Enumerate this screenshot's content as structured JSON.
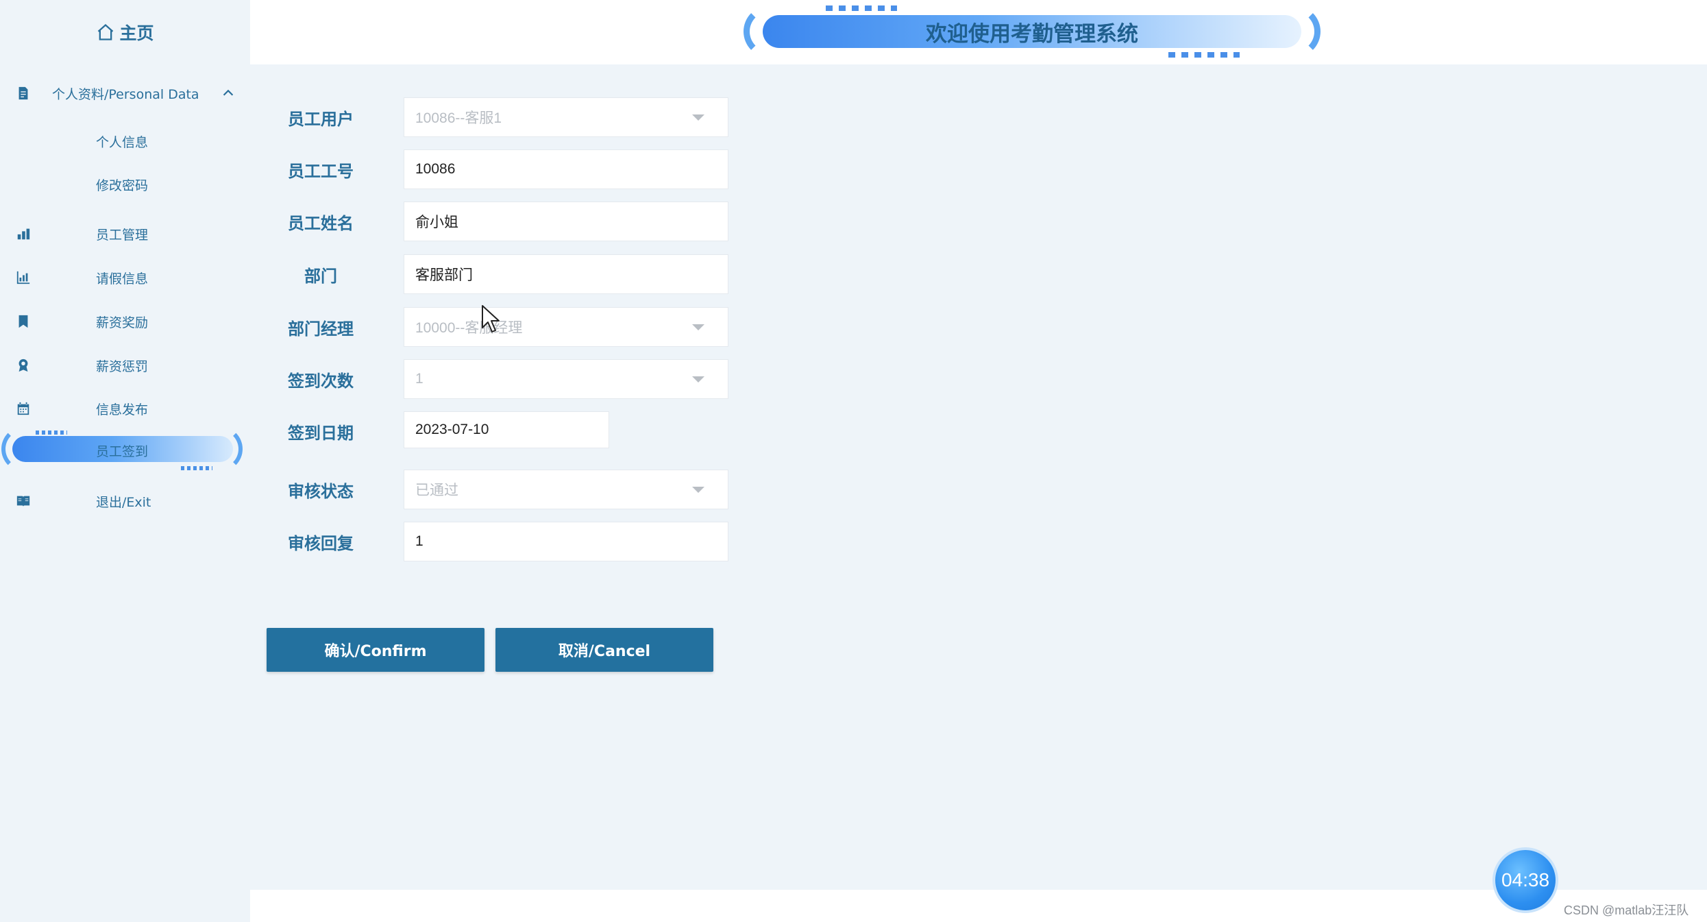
{
  "sidebar": {
    "home_label": "主页",
    "group": {
      "label": "个人资料/Personal Data"
    },
    "sub_items": [
      {
        "label": "个人信息"
      },
      {
        "label": "修改密码"
      }
    ],
    "items": [
      {
        "label": "员工管理",
        "icon": "building-chart-icon"
      },
      {
        "label": "请假信息",
        "icon": "bar-chart-icon"
      },
      {
        "label": "薪资奖励",
        "icon": "bookmark-icon"
      },
      {
        "label": "薪资惩罚",
        "icon": "badge-icon"
      },
      {
        "label": "信息发布",
        "icon": "calendar-icon"
      },
      {
        "label": "员工签到",
        "icon": "",
        "active": true
      },
      {
        "label": "退出/Exit",
        "icon": "book-icon"
      }
    ]
  },
  "header": {
    "title": "欢迎使用考勤管理系统"
  },
  "form": {
    "fields": [
      {
        "label": "员工用户",
        "value": "10086--客服1",
        "type": "select",
        "disabled": true
      },
      {
        "label": "员工工号",
        "value": "10086",
        "type": "text"
      },
      {
        "label": "员工姓名",
        "value": "俞小姐",
        "type": "text"
      },
      {
        "label": "部门",
        "value": "客服部门",
        "type": "text"
      },
      {
        "label": "部门经理",
        "value": "10000--客服经理",
        "type": "select",
        "disabled": true
      },
      {
        "label": "签到次数",
        "value": "1",
        "type": "select",
        "disabled": true
      },
      {
        "label": "签到日期",
        "value": "2023-07-10",
        "type": "date"
      },
      {
        "label": "审核状态",
        "value": "已通过",
        "type": "select",
        "disabled": true
      },
      {
        "label": "审核回复",
        "value": "1",
        "type": "text"
      }
    ],
    "confirm_label": "确认/Confirm",
    "cancel_label": "取消/Cancel"
  },
  "overlay": {
    "timer": "04:38",
    "watermark": "CSDN @matlab汪汪队"
  },
  "colors": {
    "accent": "#23719f",
    "text_blue": "#2a6f9b",
    "bg": "#eef4f9"
  }
}
